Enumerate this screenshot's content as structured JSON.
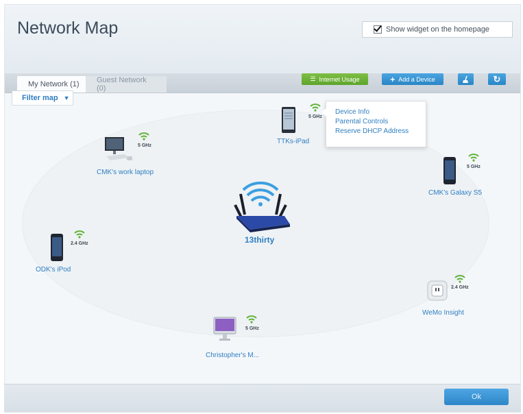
{
  "title": "Network Map",
  "widget_option": {
    "label": "Show widget on the homepage",
    "checked": true
  },
  "tabs": [
    {
      "label": "My Network (1)",
      "active": true
    },
    {
      "label": "Guest Network (0)",
      "active": false
    }
  ],
  "toolbar": {
    "internet_usage": "Internet Usage",
    "add_device": "Add a Device"
  },
  "filter": {
    "label": "Filter map"
  },
  "router": {
    "name": "13thirty"
  },
  "devices": [
    {
      "name": "TTKs-iPad",
      "band": "5 GHz",
      "type": "tablet"
    },
    {
      "name": "CMK's work laptop",
      "band": "5 GHz",
      "type": "desktop"
    },
    {
      "name": "CMK's Galaxy S5",
      "band": "5 GHz",
      "type": "phone"
    },
    {
      "name": "ODK's iPod",
      "band": "2.4 GHz",
      "type": "phone"
    },
    {
      "name": "WeMo Insight",
      "band": "2.4 GHz",
      "type": "smart-plug"
    },
    {
      "name": "Christopher's M...",
      "band": "5 GHz",
      "type": "imac"
    }
  ],
  "context_menu": {
    "items": [
      "Device Info",
      "Parental Controls",
      "Reserve DHCP Address"
    ]
  },
  "footer": {
    "ok_label": "Ok"
  },
  "colors": {
    "accent": "#2f7ec2",
    "wifi_green": "#5fb236",
    "button_green": "#6db23a",
    "button_blue": "#3a96d6"
  }
}
